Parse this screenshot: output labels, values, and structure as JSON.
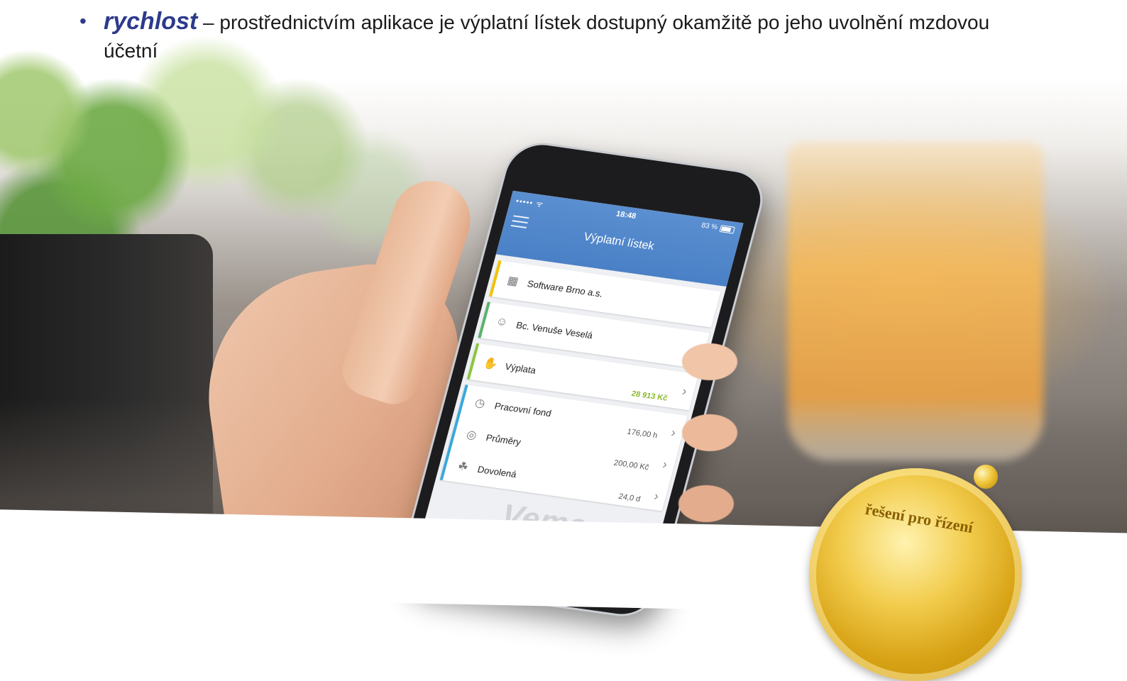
{
  "intro": {
    "bullet": "•",
    "term": "rychlost",
    "text": " – prostřednictvím aplikace je výplatní lístek dostupný okamžitě po jeho uvolnění mzdovou účetní"
  },
  "app": {
    "status": {
      "signal": "••••• ᯤ",
      "time": "18:48",
      "battery": "83 %"
    },
    "title": "Výplatní lístek",
    "rows": {
      "company": {
        "label": "Software Brno a.s.",
        "icon": "building-icon"
      },
      "person": {
        "label": "Bc. Venuše Veselá",
        "icon": "user-icon"
      },
      "salary": {
        "label": "Výplata",
        "value": "28 913 Kč",
        "icon": "money-hand-icon"
      },
      "work_fund": {
        "label": "Pracovní fond",
        "value": "176,00 h",
        "icon": "clock-icon"
      },
      "averages": {
        "label": "Průměry",
        "value": "200,00 Kč",
        "icon": "coins-icon"
      },
      "vacation": {
        "label": "Dovolená",
        "value": "24,0 d",
        "icon": "palm-tree-icon"
      }
    },
    "logo": "Vema"
  },
  "seal": {
    "text": "řešení pro řízení"
  },
  "colors": {
    "header": "#4a80c6",
    "accent_text": "#2d3a8c",
    "salary_value": "#8ab82a",
    "seal_gold": "#d8a316"
  }
}
